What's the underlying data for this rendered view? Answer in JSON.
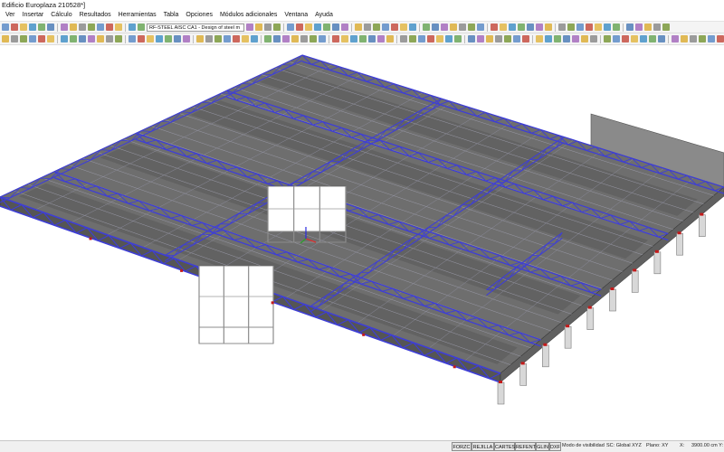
{
  "window": {
    "title": "Edificio Europlaza 210528*]"
  },
  "menu": [
    "Ver",
    "Insertar",
    "Cálculo",
    "Resultados",
    "Herramientas",
    "Tabla",
    "Opciones",
    "Módulos adicionales",
    "Ventana",
    "Ayuda"
  ],
  "toolbar": {
    "module_combo": "RF-STEEL AISC CA1 - Design of steel m"
  },
  "statusbar": {
    "toggles": [
      "FORZC",
      "REJILLA",
      "CARTES",
      "REFENT",
      "GLIN",
      "DXF"
    ],
    "visibility": "Modo de visibilidad",
    "coord_system": "SC: Global XYZ",
    "plane": "Plano: XY",
    "coord_x": "X: ",
    "coord_y": "3900.00 cm Y:"
  },
  "colors": {
    "truss": "#3e3ed6",
    "slab": "#6e6e6e",
    "support": "#d8d8d8",
    "release": "#c41a1a"
  }
}
